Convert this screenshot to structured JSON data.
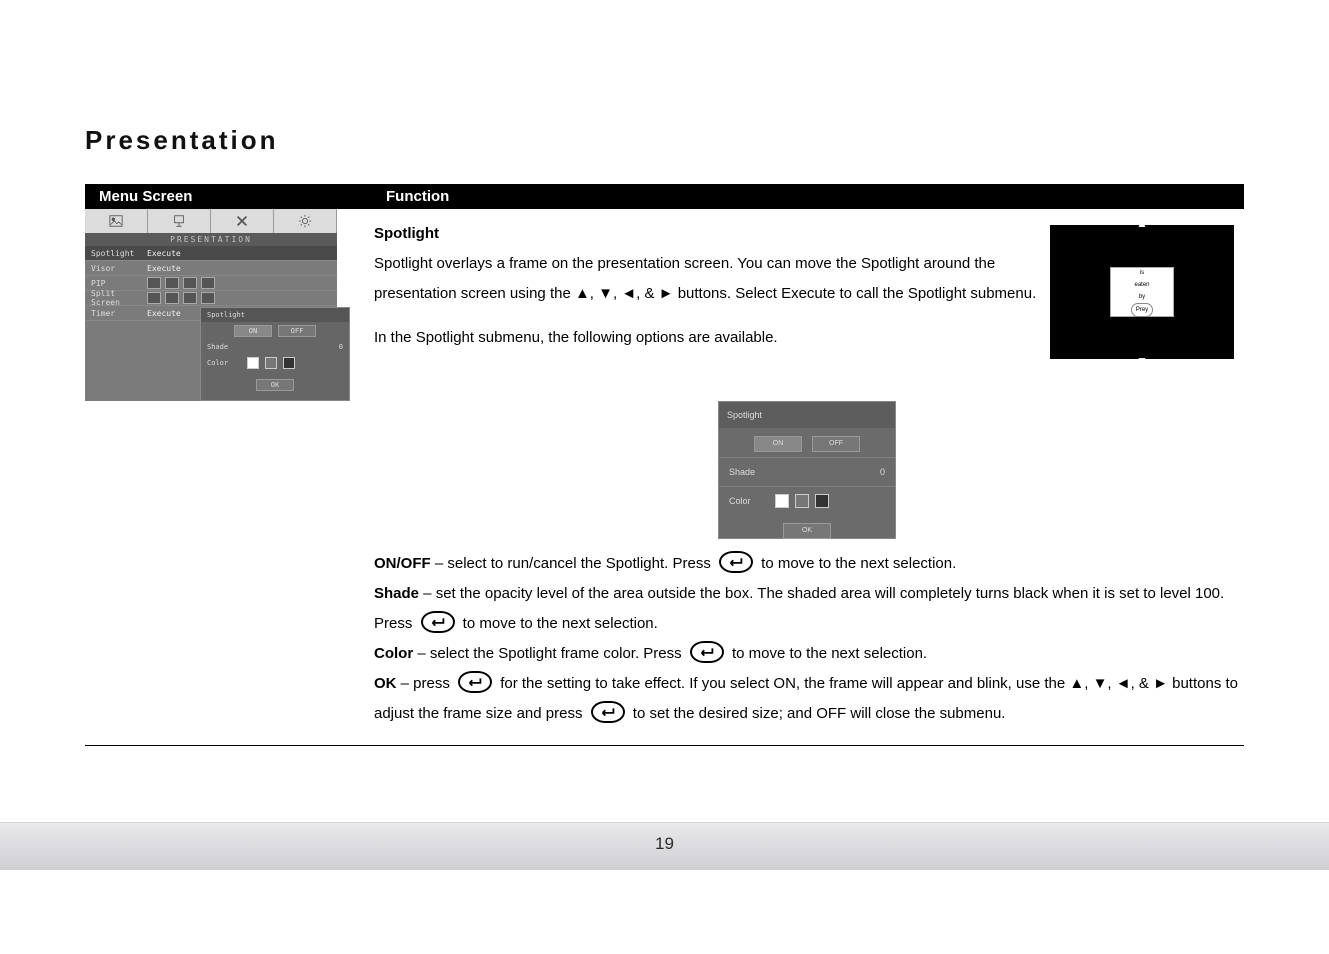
{
  "title": "Presentation",
  "header": {
    "menu_screen": "Menu Screen",
    "function": "Function"
  },
  "menu_shot": {
    "band": "PRESENTATION",
    "rows": [
      {
        "label": "Spotlight",
        "value": "Execute",
        "active": true
      },
      {
        "label": "Visor",
        "value": "Execute"
      },
      {
        "label": "PIP",
        "value": ""
      },
      {
        "label": "Split Screen",
        "value": ""
      },
      {
        "label": "Timer",
        "value": "Execute"
      }
    ],
    "sub": {
      "title": "Spotlight",
      "on": "ON",
      "off": "OFF",
      "shade_label": "Shade",
      "shade_value": "0",
      "color_label": "Color",
      "ok": "OK"
    }
  },
  "spot_preview": {
    "line1": "is",
    "line2": "eaten",
    "line3": "by",
    "line4": "Prey"
  },
  "spotlight": {
    "heading": "Spotlight",
    "p1": "Spotlight overlays a frame on the presentation screen. You can move the Spotlight around the presentation screen using the ▲, ▼, ◄, & ► buttons. Select Execute to call the Spotlight submenu.",
    "p2": "In the Spotlight submenu, the following options are available.",
    "onoff_label": "ON/OFF",
    "onoff_text": " – select to run/cancel the Spotlight. Press ",
    "onoff_text2": " to move to the next selection.",
    "shade_label": "Shade",
    "shade_text": " – set the opacity level of the area outside the box. The shaded area will completely turns black when it is set to level 100. Press ",
    "shade_text2": " to move to the next selection.",
    "color_label": "Color",
    "color_text": " – select the Spotlight frame color. Press ",
    "color_text2": " to move to the next selection.",
    "ok_label": "OK",
    "ok_text": " – press ",
    "ok_text2": " for the setting to take effect.    If you select ON, the frame will appear and blink, use the ▲, ▼, ◄, & ► buttons to adjust the frame size and press ",
    "ok_text3": " to set the desired size; and OFF will close the submenu."
  },
  "page_number": "19"
}
